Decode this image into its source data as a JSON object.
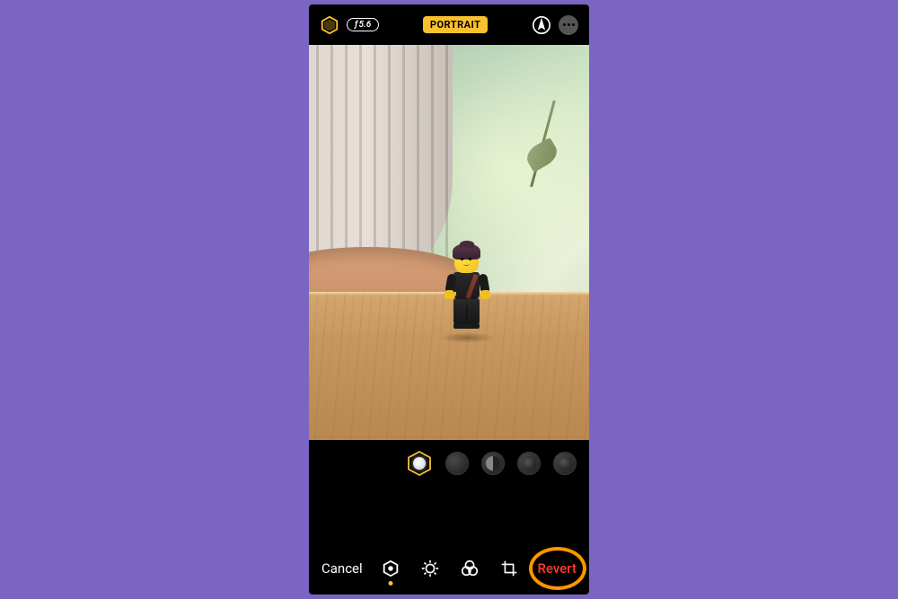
{
  "header": {
    "aperture_prefix": "ƒ",
    "aperture_value": "5.6",
    "mode_badge": "PORTRAIT"
  },
  "lighting": {
    "options": [
      "natural",
      "studio",
      "contour",
      "stage",
      "stage-mono"
    ],
    "selected_index": 0
  },
  "toolbar": {
    "cancel_label": "Cancel",
    "revert_label": "Revert",
    "tools": [
      "portrait-lighting",
      "adjust",
      "filters",
      "crop"
    ],
    "active_tool_index": 0
  },
  "colors": {
    "accent": "#fbc02d",
    "destructive": "#ff3b30",
    "highlight_ring": "#ff9500",
    "background": "#7a66c2"
  }
}
